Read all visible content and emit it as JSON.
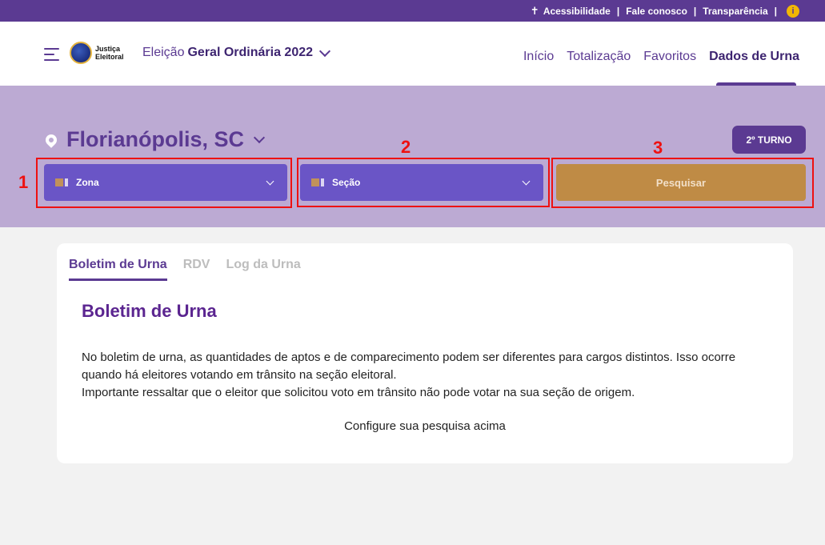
{
  "topbar": {
    "accessibility": "Acessibilidade",
    "contact": "Fale conosco",
    "transparency": "Transparência",
    "separator": "|",
    "info_icon": "i"
  },
  "header": {
    "logo_line1": "Justiça",
    "logo_line2": "Eleitoral",
    "election_prefix": "Eleição",
    "election_name": "Geral Ordinária 2022",
    "nav": [
      "Início",
      "Totalização",
      "Favoritos",
      "Dados de Urna"
    ],
    "active_nav": "Dados de Urna"
  },
  "search": {
    "location": "Florianópolis, SC",
    "turno_button": "2º TURNO",
    "zona_label": "Zona",
    "secao_label": "Seção",
    "search_button": "Pesquisar"
  },
  "annotations": [
    "1",
    "2",
    "3"
  ],
  "card": {
    "tabs": [
      "Boletim de Urna",
      "RDV",
      "Log da Urna"
    ],
    "title": "Boletim de Urna",
    "paragraph_line1": "No boletim de urna, as quantidades de aptos e de comparecimento podem ser diferentes para cargos distintos. Isso ocorre quando há eleitores votando em trânsito na seção eleitoral.",
    "paragraph_line2": "Importante ressaltar que o eleitor que solicitou voto em trânsito não pode votar na sua seção de origem.",
    "hint": "Configure sua pesquisa acima"
  },
  "colors": {
    "primary": "#5b3a92",
    "band": "#bcaad3",
    "select": "#6a55c6",
    "search_button": "#bf8b45",
    "annotation": "#ee1111"
  }
}
